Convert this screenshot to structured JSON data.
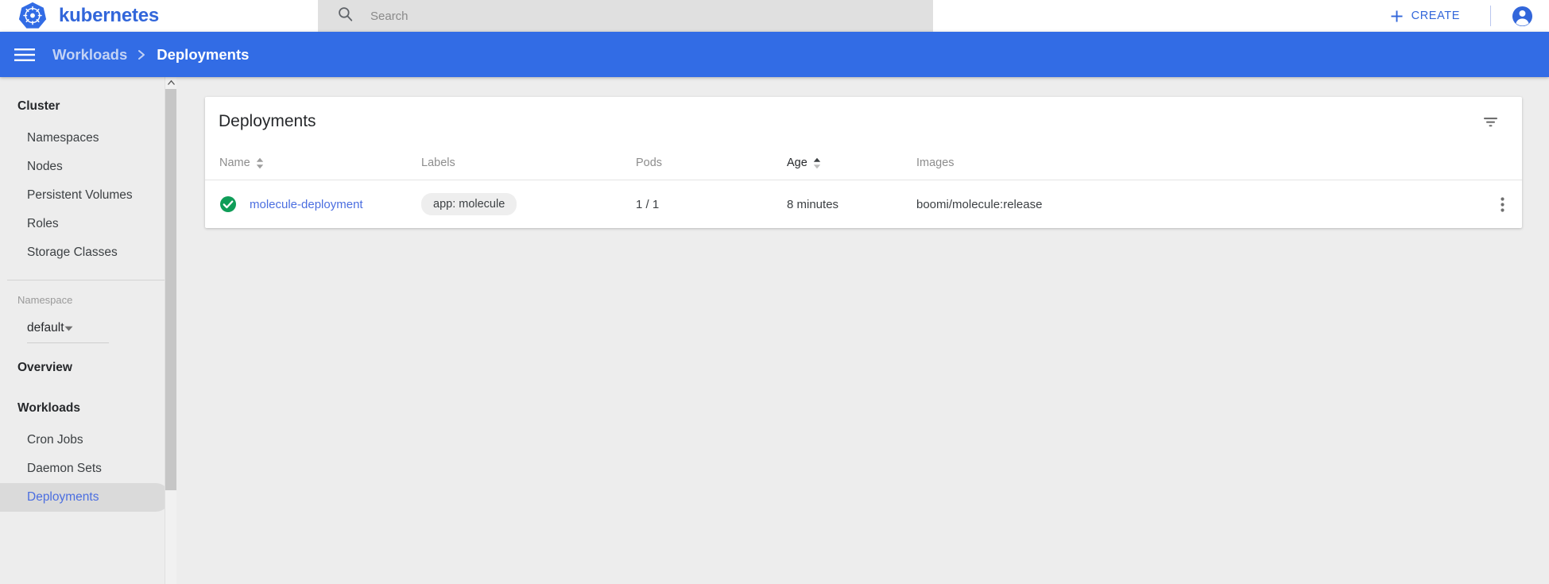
{
  "topbar": {
    "brand_name": "kubernetes",
    "logo_icon": "kubernetes-helm-logo",
    "search": {
      "icon": "search-icon",
      "placeholder": "Search",
      "value": ""
    },
    "create_button": {
      "icon": "plus-icon",
      "label": "CREATE"
    },
    "account_icon": "account-circle-icon"
  },
  "breadcrumb": {
    "menu_icon": "hamburger-menu-icon",
    "separator_icon": "chevron-right-icon",
    "parent": "Workloads",
    "current": "Deployments"
  },
  "sidebar": {
    "cluster_section": {
      "title": "Cluster",
      "items": [
        {
          "label": "Namespaces"
        },
        {
          "label": "Nodes"
        },
        {
          "label": "Persistent Volumes"
        },
        {
          "label": "Roles"
        },
        {
          "label": "Storage Classes"
        }
      ]
    },
    "namespace": {
      "label": "Namespace",
      "selected": "default",
      "caret_icon": "chevron-down-icon"
    },
    "overview": {
      "title": "Overview"
    },
    "workloads_section": {
      "title": "Workloads",
      "items": [
        {
          "label": "Cron Jobs",
          "selected": false
        },
        {
          "label": "Daemon Sets",
          "selected": false
        },
        {
          "label": "Deployments",
          "selected": true
        }
      ]
    },
    "scrollbar": {
      "up_arrow_icon": "scroll-up-arrow-icon"
    }
  },
  "main": {
    "card": {
      "title": "Deployments",
      "filter_icon": "filter-icon",
      "table": {
        "columns": [
          {
            "label": "Name",
            "sortable": true,
            "sorted": false
          },
          {
            "label": "Labels",
            "sortable": false,
            "sorted": false
          },
          {
            "label": "Pods",
            "sortable": false,
            "sorted": false
          },
          {
            "label": "Age",
            "sortable": true,
            "sorted": true
          },
          {
            "label": "Images",
            "sortable": false,
            "sorted": false
          }
        ],
        "rows": [
          {
            "status_icon": "success-check-circle-icon",
            "status_color": "#0f9d58",
            "name": "molecule-deployment",
            "labels": "app: molecule",
            "pods": "1 / 1",
            "age": "8 minutes",
            "images": "boomi/molecule:release",
            "menu_icon": "more-vert-icon"
          }
        ]
      }
    }
  },
  "colors": {
    "brand_blue": "#326ce5",
    "link_blue": "#4b6ee0",
    "success_green": "#0f9d58",
    "page_bg": "#ededed"
  }
}
